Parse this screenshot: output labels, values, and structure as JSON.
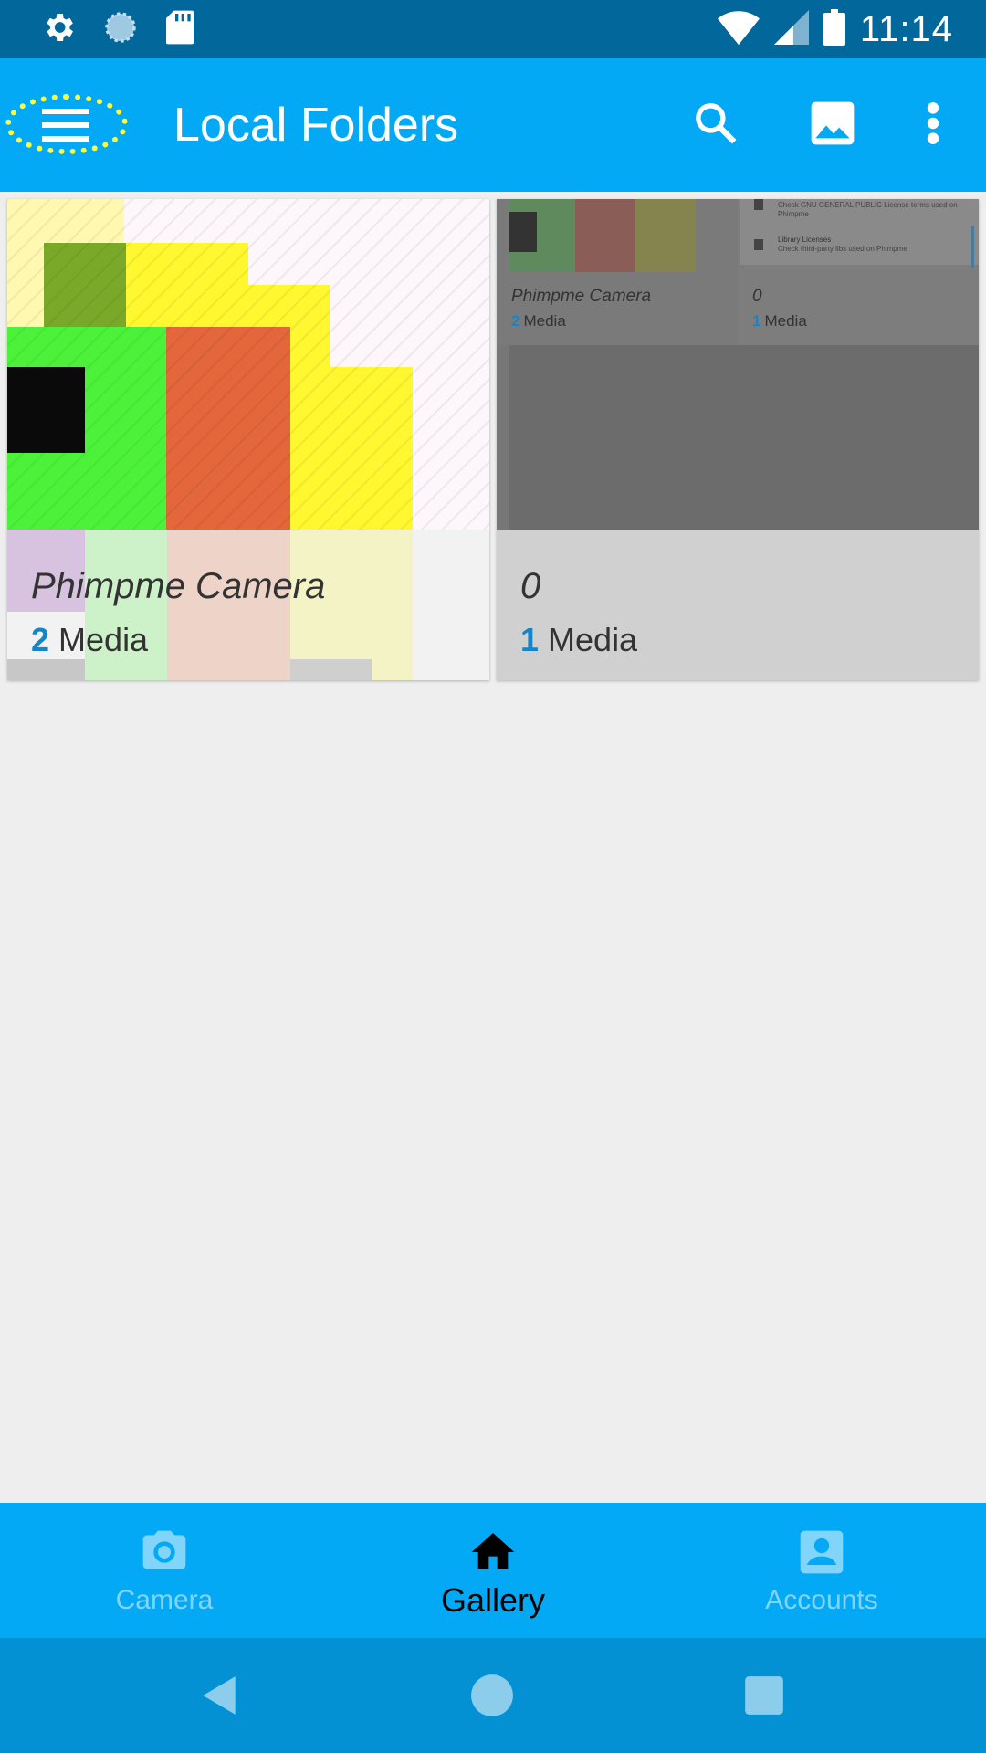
{
  "status_bar": {
    "time": "11:14",
    "left_icons": [
      "settings-icon",
      "sync-icon",
      "sd-card-icon"
    ],
    "right_icons": [
      "wifi-icon",
      "signal-icon",
      "battery-icon"
    ]
  },
  "app_bar": {
    "title": "Local Folders",
    "actions": [
      "search-icon",
      "image-icon",
      "more-vert-icon"
    ]
  },
  "folders": [
    {
      "name": "Phimpme Camera",
      "count": "2",
      "count_label": "Media"
    },
    {
      "name": "0",
      "count": "1",
      "count_label": "Media"
    }
  ],
  "thumbnail_preview": {
    "folders": [
      {
        "name": "Phimpme Camera",
        "count": "2",
        "count_label": "Media"
      },
      {
        "name": "0",
        "count": "1",
        "count_label": "Media"
      }
    ],
    "list_items": [
      {
        "title": "",
        "subtitle": "Check GNU GENERAL PUBLIC License terms used on Phimpme"
      },
      {
        "title": "Library Licenses",
        "subtitle": "Check third-party libs used on Phimpme"
      }
    ]
  },
  "bottom_nav": [
    {
      "label": "Camera",
      "icon": "camera-icon",
      "active": false
    },
    {
      "label": "Gallery",
      "icon": "home-icon",
      "active": true
    },
    {
      "label": "Accounts",
      "icon": "account-box-icon",
      "active": false
    }
  ],
  "colors": {
    "status_bar": "#02679a",
    "primary": "#03a9f4",
    "accent_count": "#1784c8",
    "background": "#eeeeee"
  }
}
